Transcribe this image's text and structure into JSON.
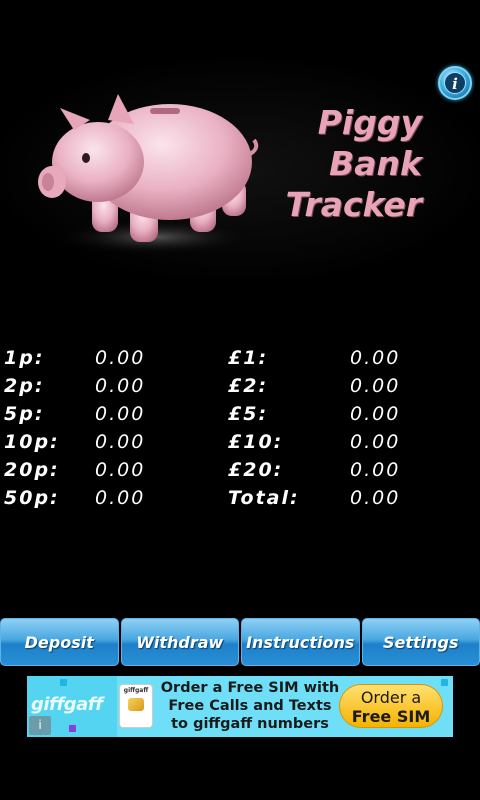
{
  "header": {
    "title_lines": [
      "Piggy",
      "Bank",
      "Tracker"
    ],
    "info_icon": "info-icon",
    "pig_icon": "piggy-bank-icon",
    "title_color": "#e8a3b7"
  },
  "coins": {
    "rows": [
      {
        "label_left": "1p:",
        "value_left": "0.00",
        "label_right": "£1:",
        "value_right": "0.00"
      },
      {
        "label_left": "2p:",
        "value_left": "0.00",
        "label_right": "£2:",
        "value_right": "0.00"
      },
      {
        "label_left": "5p:",
        "value_left": "0.00",
        "label_right": "£5:",
        "value_right": "0.00"
      },
      {
        "label_left": "10p:",
        "value_left": "0.00",
        "label_right": "£10:",
        "value_right": "0.00"
      },
      {
        "label_left": "20p:",
        "value_left": "0.00",
        "label_right": "£20:",
        "value_right": "0.00"
      },
      {
        "label_left": "50p:",
        "value_left": "0.00",
        "label_right": "Total:",
        "value_right": "0.00"
      }
    ]
  },
  "toolbar": {
    "deposit_label": "Deposit",
    "withdraw_label": "Withdraw",
    "instructions_label": "Instructions",
    "settings_label": "Settings",
    "button_color": "#2a8fd6"
  },
  "ad": {
    "brand": "giffgaff",
    "sim_label": "giffgaff",
    "line1": "Order a Free SIM with",
    "line2": "Free Calls and Texts",
    "line3": "to giffgaff numbers",
    "cta_line1": "Order a",
    "cta_line2": "Free SIM",
    "info_glyph": "i",
    "background": "#6fdff8"
  }
}
